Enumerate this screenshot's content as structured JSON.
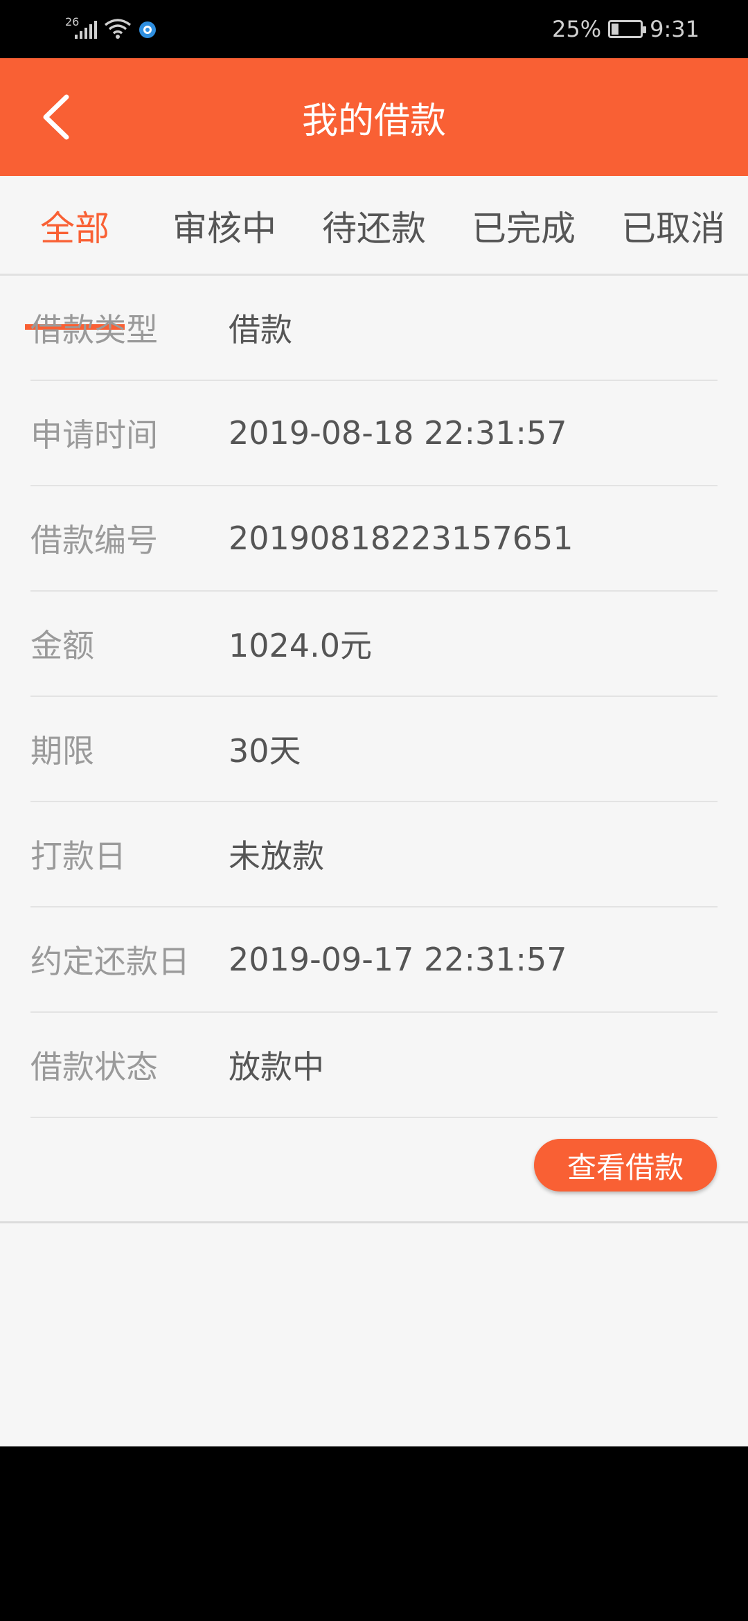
{
  "status_bar": {
    "network": "26",
    "battery": "25%",
    "time": "9:31",
    "icons": [
      "signal-icon",
      "wifi-icon",
      "app-notification-icon",
      "battery-icon"
    ]
  },
  "header": {
    "title": "我的借款",
    "back_icon": "chevron-left-icon"
  },
  "tabs": [
    {
      "label": "全部",
      "active": true
    },
    {
      "label": "审核中",
      "active": false
    },
    {
      "label": "待还款",
      "active": false
    },
    {
      "label": "已完成",
      "active": false
    },
    {
      "label": "已取消",
      "active": false
    }
  ],
  "loan": {
    "rows": [
      {
        "label": "借款类型",
        "value": "借款"
      },
      {
        "label": "申请时间",
        "value": "2019-08-18 22:31:57"
      },
      {
        "label": "借款编号",
        "value": "20190818223157651"
      },
      {
        "label": "金额",
        "value": "1024.0元"
      },
      {
        "label": "期限",
        "value": "30天"
      },
      {
        "label": "打款日",
        "value": "未放款"
      },
      {
        "label": "约定还款日",
        "value": "2019-09-17 22:31:57"
      },
      {
        "label": "借款状态",
        "value": "放款中"
      }
    ],
    "view_button": "查看借款"
  },
  "colors": {
    "accent": "#f96034",
    "background": "#f6f6f6",
    "label_text": "#9a9a9a",
    "value_text": "#555555"
  }
}
